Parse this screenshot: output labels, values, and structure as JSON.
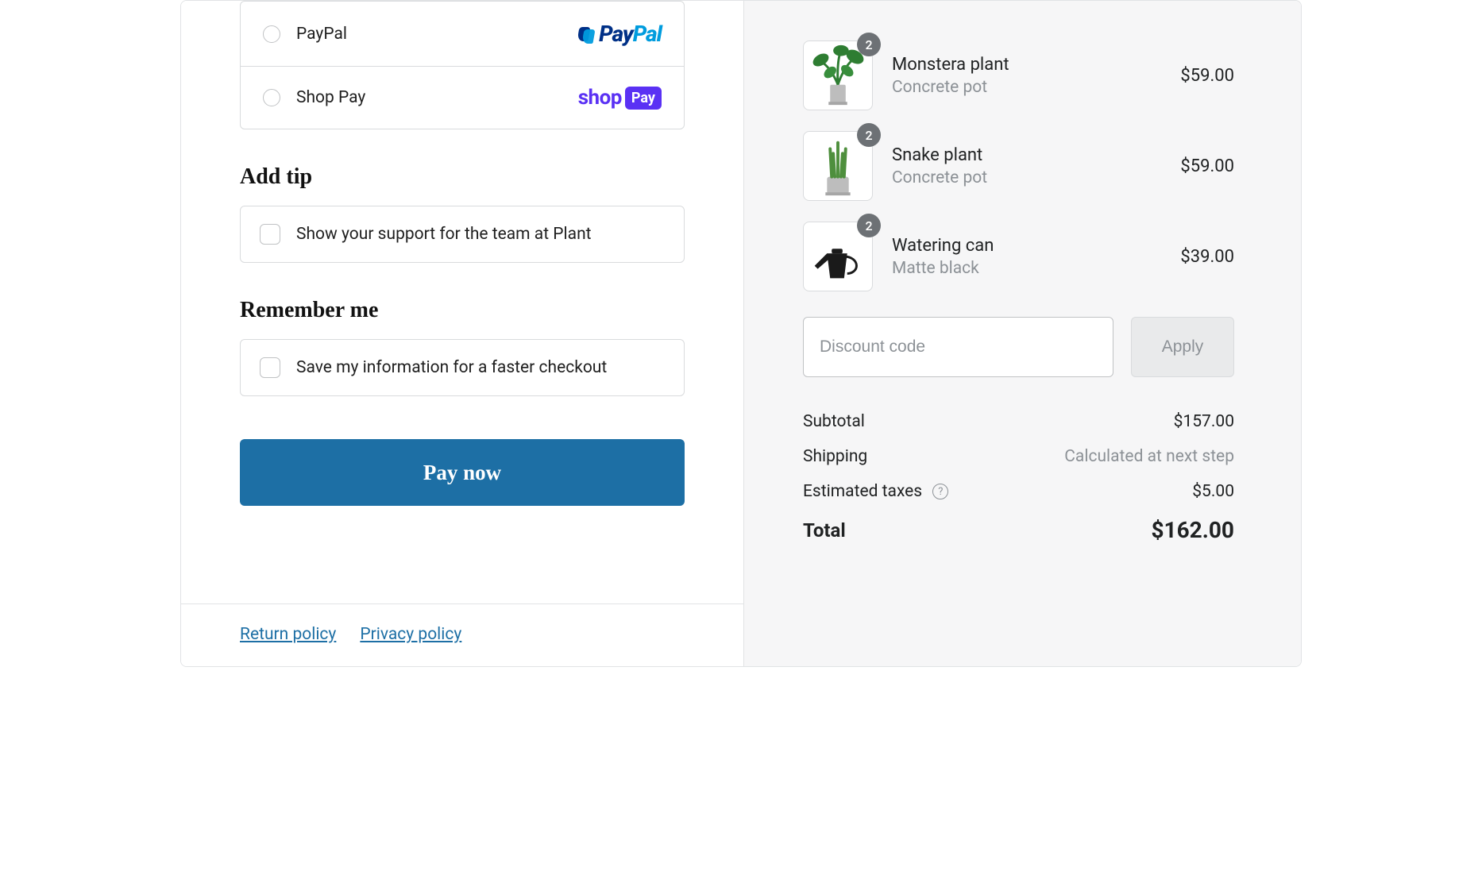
{
  "payment_methods": {
    "paypal": {
      "label": "PayPal"
    },
    "shoppay": {
      "label": "Shop Pay"
    }
  },
  "tip": {
    "heading": "Add tip",
    "checkbox_label": "Show your support for the team at Plant"
  },
  "remember": {
    "heading": "Remember me",
    "checkbox_label": "Save my information for a faster checkout"
  },
  "pay_button": "Pay now",
  "footer": {
    "return_policy": "Return policy",
    "privacy_policy": "Privacy policy"
  },
  "cart": {
    "items": [
      {
        "name": "Monstera plant",
        "variant": "Concrete pot",
        "qty": "2",
        "price": "$59.00"
      },
      {
        "name": "Snake plant",
        "variant": "Concrete pot",
        "qty": "2",
        "price": "$59.00"
      },
      {
        "name": "Watering can",
        "variant": "Matte black",
        "qty": "2",
        "price": "$39.00"
      }
    ],
    "discount_placeholder": "Discount code",
    "apply_label": "Apply",
    "subtotal_label": "Subtotal",
    "subtotal_value": "$157.00",
    "shipping_label": "Shipping",
    "shipping_value": "Calculated at next step",
    "taxes_label": "Estimated taxes",
    "taxes_value": "$5.00",
    "total_label": "Total",
    "total_value": "$162.00"
  }
}
